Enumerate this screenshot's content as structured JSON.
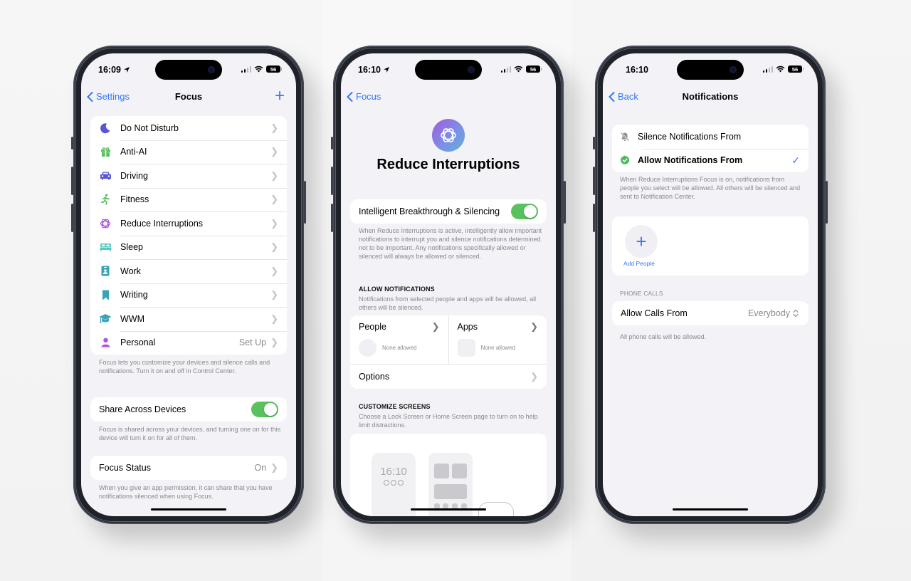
{
  "phones": [
    {
      "status": {
        "time": "16:09",
        "location_icon": "location-arrow-icon",
        "battery": "56"
      },
      "nav": {
        "back_label": "Settings",
        "title": "Focus",
        "add_icon": "plus-icon"
      },
      "focus_modes": [
        {
          "label": "Do Not Disturb",
          "icon": "moon-icon",
          "color": "#5856d6",
          "value": ""
        },
        {
          "label": "Anti-AI",
          "icon": "gift-icon",
          "color": "#5ac15f",
          "value": ""
        },
        {
          "label": "Driving",
          "icon": "car-icon",
          "color": "#5856d6",
          "value": ""
        },
        {
          "label": "Fitness",
          "icon": "running-icon",
          "color": "#5ac15f",
          "value": ""
        },
        {
          "label": "Reduce Interruptions",
          "icon": "interruptions-icon",
          "color": "#af52de",
          "value": ""
        },
        {
          "label": "Sleep",
          "icon": "bed-icon",
          "color": "#5ac8c0",
          "value": ""
        },
        {
          "label": "Work",
          "icon": "id-badge-icon",
          "color": "#3ba3b8",
          "value": ""
        },
        {
          "label": "Writing",
          "icon": "bookmark-icon",
          "color": "#3ba3b8",
          "value": ""
        },
        {
          "label": "WWM",
          "icon": "graduation-cap-icon",
          "color": "#3ba3b8",
          "value": ""
        },
        {
          "label": "Personal",
          "icon": "person-icon",
          "color": "#af52de",
          "value": "Set Up"
        }
      ],
      "focus_footer": "Focus lets you customize your devices and silence calls and notifications. Turn it on and off in Control Center.",
      "share": {
        "label": "Share Across Devices",
        "enabled": true,
        "footer": "Focus is shared across your devices, and turning one on for this device will turn it on for all of them."
      },
      "focus_status": {
        "label": "Focus Status",
        "value": "On",
        "footer": "When you give an app permission, it can share that you have notifications silenced when using Focus."
      }
    },
    {
      "status": {
        "time": "16:10",
        "location_icon": "location-arrow-icon",
        "battery": "56"
      },
      "nav": {
        "back_label": "Focus"
      },
      "hero": {
        "title": "Reduce Interruptions",
        "icon": "interruptions-icon"
      },
      "breakthrough": {
        "label": "Intelligent Breakthrough & Silencing",
        "enabled": true,
        "footer": "When Reduce Interruptions is active, intelligently allow important notifications to interrupt you and silence notifications determined not to be important. Any notifications specifically allowed or silenced will always be allowed or silenced."
      },
      "allow_notifications": {
        "header": "ALLOW NOTIFICATIONS",
        "subheader": "Notifications from selected people and apps will be allowed, all others will be silenced.",
        "people": {
          "label": "People",
          "value": "None allowed"
        },
        "apps": {
          "label": "Apps",
          "value": "None allowed"
        },
        "options_label": "Options"
      },
      "customize_screens": {
        "header": "CUSTOMIZE SCREENS",
        "subheader": "Choose a Lock Screen or Home Screen page to turn on to help limit distractions.",
        "lock_screen_time": "16:10"
      }
    },
    {
      "status": {
        "time": "16:10",
        "battery": "56"
      },
      "nav": {
        "back_label": "Back",
        "title": "Notifications"
      },
      "mode_options": [
        {
          "label": "Silence Notifications From",
          "icon": "bell-slash-icon",
          "selected": false
        },
        {
          "label": "Allow Notifications From",
          "icon": "checkmark-seal-icon",
          "selected": true
        }
      ],
      "mode_footer": "When Reduce Interruptions Focus is on, notifications from people you select will be allowed. All others will be silenced and sent to Notification Center.",
      "add_people_label": "Add People",
      "phone_calls": {
        "header": "PHONE CALLS",
        "label": "Allow Calls From",
        "value": "Everybody",
        "footer": "All phone calls will be allowed."
      }
    }
  ],
  "colors": {
    "accent": "#3478f6",
    "toggle_on": "#5ac15f",
    "grouped_bg": "#f2f2f7"
  }
}
